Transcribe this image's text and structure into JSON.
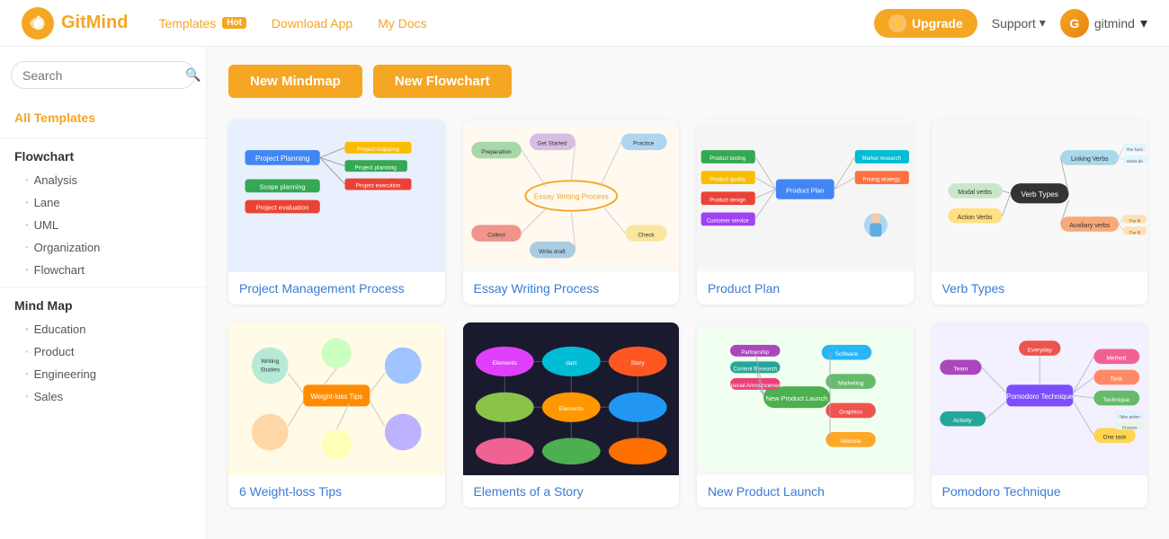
{
  "header": {
    "logo_text": "GitMind",
    "nav": [
      {
        "label": "Templates",
        "badge": "Hot",
        "id": "templates"
      },
      {
        "label": "Download App",
        "id": "download"
      },
      {
        "label": "My Docs",
        "id": "mydocs"
      }
    ],
    "upgrade_label": "Upgrade",
    "support_label": "Support",
    "user_name": "gitmind"
  },
  "sidebar": {
    "search_placeholder": "Search",
    "items": [
      {
        "label": "All Templates",
        "id": "all-templates",
        "type": "section",
        "active": true
      },
      {
        "label": "Flowchart",
        "id": "flowchart",
        "type": "group"
      },
      {
        "label": "Analysis",
        "id": "analysis",
        "type": "item"
      },
      {
        "label": "Lane",
        "id": "lane",
        "type": "item"
      },
      {
        "label": "UML",
        "id": "uml",
        "type": "item"
      },
      {
        "label": "Organization",
        "id": "organization",
        "type": "item"
      },
      {
        "label": "Flowchart",
        "id": "flowchart2",
        "type": "item"
      },
      {
        "label": "Mind Map",
        "id": "mindmap",
        "type": "group"
      },
      {
        "label": "Education",
        "id": "education",
        "type": "item"
      },
      {
        "label": "Product",
        "id": "product",
        "type": "item"
      },
      {
        "label": "Engineering",
        "id": "engineering",
        "type": "item"
      },
      {
        "label": "Sales",
        "id": "sales",
        "type": "item"
      }
    ]
  },
  "main": {
    "new_mindmap_label": "New Mindmap",
    "new_flowchart_label": "New Flowchart",
    "templates": [
      {
        "id": "project-management",
        "label": "Project Management Process",
        "thumb_type": "blue"
      },
      {
        "id": "essay-writing",
        "label": "Essay Writing Process",
        "thumb_type": "light"
      },
      {
        "id": "product-plan",
        "label": "Product Plan",
        "thumb_type": "light"
      },
      {
        "id": "verb-types",
        "label": "Verb Types",
        "thumb_type": "light"
      },
      {
        "id": "weight-loss",
        "label": "6 Weight-loss Tips",
        "thumb_type": "yellow"
      },
      {
        "id": "elements-story",
        "label": "Elements of a Story",
        "thumb_type": "dark"
      },
      {
        "id": "new-product-launch",
        "label": "New Product Launch",
        "thumb_type": "light"
      },
      {
        "id": "pomodoro",
        "label": "Pomodoro Technique",
        "thumb_type": "lavender"
      }
    ]
  }
}
